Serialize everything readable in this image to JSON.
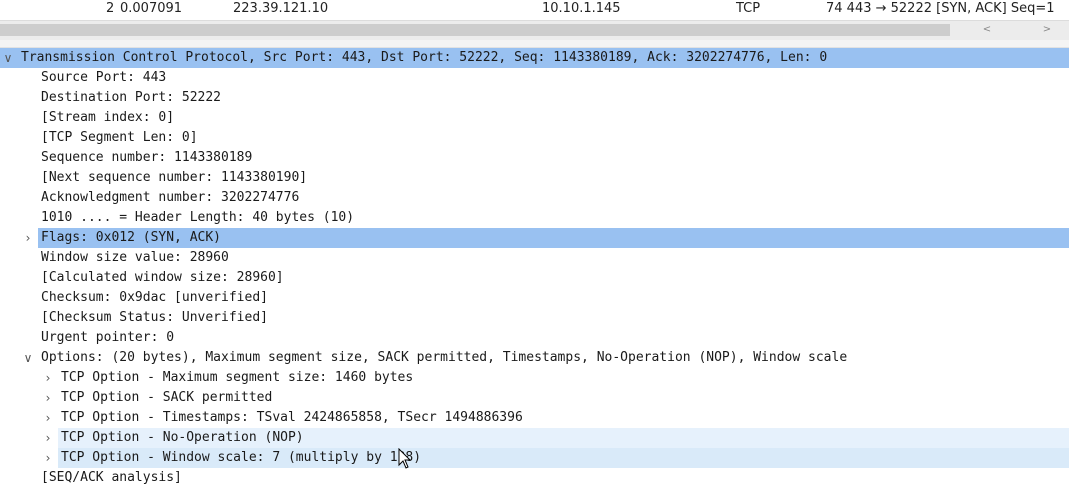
{
  "packet_list": {
    "row": {
      "no": "2",
      "time": "0.007091",
      "source": "223.39.121.10",
      "destination": "10.10.1.145",
      "protocol": "TCP",
      "info": "74 443 → 52222 [SYN, ACK] Seq=1"
    }
  },
  "tree": {
    "header": "Transmission Control Protocol, Src Port: 443, Dst Port: 52222, Seq: 1143380189, Ack: 3202274776, Len: 0",
    "fields": [
      "Source Port: 443",
      "Destination Port: 52222",
      "[Stream index: 0]",
      "[TCP Segment Len: 0]",
      "Sequence number: 1143380189",
      "[Next sequence number: 1143380190]",
      "Acknowledgment number: 3202274776",
      "1010 .... = Header Length: 40 bytes (10)"
    ],
    "flags": "Flags: 0x012 (SYN, ACK)",
    "fields2": [
      "Window size value: 28960",
      "[Calculated window size: 28960]",
      "Checksum: 0x9dac [unverified]",
      "[Checksum Status: Unverified]",
      "Urgent pointer: 0"
    ],
    "options": "Options: (20 bytes), Maximum segment size, SACK permitted, Timestamps, No-Operation (NOP), Window scale",
    "option_items": [
      "TCP Option - Maximum segment size: 1460 bytes",
      "TCP Option - SACK permitted",
      "TCP Option - Timestamps: TSval 2424865858, TSecr 1494886396",
      "TCP Option - No-Operation (NOP)",
      "TCP Option - Window scale: 7 (multiply by 128)"
    ],
    "partial_last": "[SEQ/ACK analysis]"
  },
  "colors": {
    "selected": "#99c1f1",
    "hover": "#e6f1fc"
  },
  "icons": {
    "expanded": "chevron-down-icon",
    "collapsed": "chevron-right-icon"
  }
}
